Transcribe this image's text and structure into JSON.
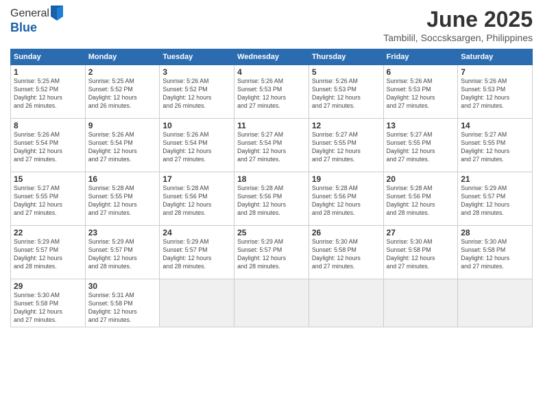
{
  "header": {
    "logo_line1": "General",
    "logo_line2": "Blue",
    "title": "June 2025",
    "location": "Tambilil, Soccsksargen, Philippines"
  },
  "calendar": {
    "days_of_week": [
      "Sunday",
      "Monday",
      "Tuesday",
      "Wednesday",
      "Thursday",
      "Friday",
      "Saturday"
    ],
    "weeks": [
      [
        {
          "day": "",
          "info": ""
        },
        {
          "day": "2",
          "info": "Sunrise: 5:25 AM\nSunset: 5:52 PM\nDaylight: 12 hours\nand 26 minutes."
        },
        {
          "day": "3",
          "info": "Sunrise: 5:26 AM\nSunset: 5:52 PM\nDaylight: 12 hours\nand 26 minutes."
        },
        {
          "day": "4",
          "info": "Sunrise: 5:26 AM\nSunset: 5:53 PM\nDaylight: 12 hours\nand 27 minutes."
        },
        {
          "day": "5",
          "info": "Sunrise: 5:26 AM\nSunset: 5:53 PM\nDaylight: 12 hours\nand 27 minutes."
        },
        {
          "day": "6",
          "info": "Sunrise: 5:26 AM\nSunset: 5:53 PM\nDaylight: 12 hours\nand 27 minutes."
        },
        {
          "day": "7",
          "info": "Sunrise: 5:26 AM\nSunset: 5:53 PM\nDaylight: 12 hours\nand 27 minutes."
        }
      ],
      [
        {
          "day": "1",
          "info": "Sunrise: 5:25 AM\nSunset: 5:52 PM\nDaylight: 12 hours\nand 26 minutes."
        },
        {
          "day": "9",
          "info": "Sunrise: 5:26 AM\nSunset: 5:54 PM\nDaylight: 12 hours\nand 27 minutes."
        },
        {
          "day": "10",
          "info": "Sunrise: 5:26 AM\nSunset: 5:54 PM\nDaylight: 12 hours\nand 27 minutes."
        },
        {
          "day": "11",
          "info": "Sunrise: 5:27 AM\nSunset: 5:54 PM\nDaylight: 12 hours\nand 27 minutes."
        },
        {
          "day": "12",
          "info": "Sunrise: 5:27 AM\nSunset: 5:55 PM\nDaylight: 12 hours\nand 27 minutes."
        },
        {
          "day": "13",
          "info": "Sunrise: 5:27 AM\nSunset: 5:55 PM\nDaylight: 12 hours\nand 27 minutes."
        },
        {
          "day": "14",
          "info": "Sunrise: 5:27 AM\nSunset: 5:55 PM\nDaylight: 12 hours\nand 27 minutes."
        }
      ],
      [
        {
          "day": "8",
          "info": "Sunrise: 5:26 AM\nSunset: 5:54 PM\nDaylight: 12 hours\nand 27 minutes."
        },
        {
          "day": "16",
          "info": "Sunrise: 5:28 AM\nSunset: 5:55 PM\nDaylight: 12 hours\nand 27 minutes."
        },
        {
          "day": "17",
          "info": "Sunrise: 5:28 AM\nSunset: 5:56 PM\nDaylight: 12 hours\nand 28 minutes."
        },
        {
          "day": "18",
          "info": "Sunrise: 5:28 AM\nSunset: 5:56 PM\nDaylight: 12 hours\nand 28 minutes."
        },
        {
          "day": "19",
          "info": "Sunrise: 5:28 AM\nSunset: 5:56 PM\nDaylight: 12 hours\nand 28 minutes."
        },
        {
          "day": "20",
          "info": "Sunrise: 5:28 AM\nSunset: 5:56 PM\nDaylight: 12 hours\nand 28 minutes."
        },
        {
          "day": "21",
          "info": "Sunrise: 5:29 AM\nSunset: 5:57 PM\nDaylight: 12 hours\nand 28 minutes."
        }
      ],
      [
        {
          "day": "15",
          "info": "Sunrise: 5:27 AM\nSunset: 5:55 PM\nDaylight: 12 hours\nand 27 minutes."
        },
        {
          "day": "23",
          "info": "Sunrise: 5:29 AM\nSunset: 5:57 PM\nDaylight: 12 hours\nand 28 minutes."
        },
        {
          "day": "24",
          "info": "Sunrise: 5:29 AM\nSunset: 5:57 PM\nDaylight: 12 hours\nand 28 minutes."
        },
        {
          "day": "25",
          "info": "Sunrise: 5:29 AM\nSunset: 5:57 PM\nDaylight: 12 hours\nand 28 minutes."
        },
        {
          "day": "26",
          "info": "Sunrise: 5:30 AM\nSunset: 5:58 PM\nDaylight: 12 hours\nand 27 minutes."
        },
        {
          "day": "27",
          "info": "Sunrise: 5:30 AM\nSunset: 5:58 PM\nDaylight: 12 hours\nand 27 minutes."
        },
        {
          "day": "28",
          "info": "Sunrise: 5:30 AM\nSunset: 5:58 PM\nDaylight: 12 hours\nand 27 minutes."
        }
      ],
      [
        {
          "day": "22",
          "info": "Sunrise: 5:29 AM\nSunset: 5:57 PM\nDaylight: 12 hours\nand 28 minutes."
        },
        {
          "day": "30",
          "info": "Sunrise: 5:31 AM\nSunset: 5:58 PM\nDaylight: 12 hours\nand 27 minutes."
        },
        {
          "day": "",
          "info": ""
        },
        {
          "day": "",
          "info": ""
        },
        {
          "day": "",
          "info": ""
        },
        {
          "day": "",
          "info": ""
        },
        {
          "day": "",
          "info": ""
        }
      ],
      [
        {
          "day": "29",
          "info": "Sunrise: 5:30 AM\nSunset: 5:58 PM\nDaylight: 12 hours\nand 27 minutes."
        },
        {
          "day": "",
          "info": ""
        },
        {
          "day": "",
          "info": ""
        },
        {
          "day": "",
          "info": ""
        },
        {
          "day": "",
          "info": ""
        },
        {
          "day": "",
          "info": ""
        },
        {
          "day": "",
          "info": ""
        }
      ]
    ]
  }
}
